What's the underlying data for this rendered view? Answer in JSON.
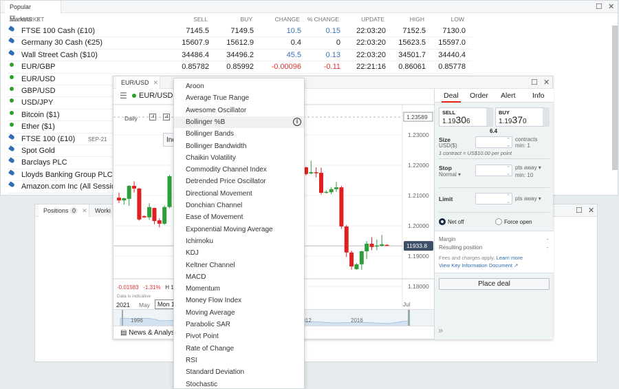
{
  "markets_panel": {
    "tab": "Popular Markets",
    "columns": [
      "MARKET",
      "SELL",
      "BUY",
      "CHANGE",
      "% CHANGE",
      "UPDATE",
      "HIGH",
      "LOW"
    ],
    "rows": [
      {
        "icon": "tag-icon",
        "name": "FTSE 100 Cash (£10)",
        "sell": "7145.5",
        "buy": "7149.5",
        "change": "10.5",
        "pct": "0.15",
        "update": "22:03:20",
        "high": "7152.5",
        "low": "7130.0",
        "dir": "up"
      },
      {
        "icon": "tag-icon",
        "name": "Germany 30 Cash (€25)",
        "sell": "15607.9",
        "buy": "15612.9",
        "change": "0.4",
        "pct": "0",
        "update": "22:03:20",
        "high": "15623.5",
        "low": "15597.0",
        "dir": "flat"
      },
      {
        "icon": "tag-icon",
        "name": "Wall Street Cash ($10)",
        "sell": "34486.4",
        "buy": "34496.2",
        "change": "45.5",
        "pct": "0.13",
        "update": "22:03:20",
        "high": "34501.7",
        "low": "34440.4",
        "dir": "up"
      },
      {
        "icon": "dot-icon",
        "name": "EUR/GBP",
        "sell": "0.85782",
        "buy": "0.85992",
        "change": "-0.00096",
        "pct": "-0.11",
        "update": "22:21:16",
        "high": "0.86061",
        "low": "0.85778",
        "dir": "down"
      },
      {
        "icon": "dot-icon",
        "name": "EUR/USD"
      },
      {
        "icon": "dot-icon",
        "name": "GBP/USD"
      },
      {
        "icon": "dot-icon",
        "name": "USD/JPY"
      },
      {
        "icon": "dot-icon",
        "name": "Bitcoin ($1)"
      },
      {
        "icon": "dot-icon",
        "name": "Ether ($1)"
      },
      {
        "icon": "tag-icon",
        "name": "FTSE 100 (£10)",
        "expiry": "SEP-21"
      },
      {
        "icon": "tag-icon",
        "name": "Spot Gold"
      },
      {
        "icon": "tag-icon",
        "name": "Barclays PLC"
      },
      {
        "icon": "tag-icon",
        "name": "Lloyds Banking Group PLC"
      },
      {
        "icon": "tag-icon",
        "name": "Amazon.com Inc (All Sessions)"
      }
    ]
  },
  "positions_panel": {
    "tab": "Positions",
    "count": "0",
    "tab2": "Worki"
  },
  "chart_window": {
    "tab": "EUR/USD",
    "market": "EUR/USD",
    "interval": "Daily",
    "indicators_btn": "Ind",
    "change": "-0.01583",
    "change_pct": "-1.31%",
    "high_prefix": "H 1.",
    "indicative": "Data is indicative",
    "x_labels": [
      "2021",
      "May",
      "Mon 10",
      "Jul"
    ],
    "nav_labels": [
      "1996",
      "2012",
      "2016"
    ],
    "news": "News & Analysis",
    "current_price": "11933.8",
    "marker_price": "1.23589",
    "y_ticks": [
      "1.23000",
      "1.22000",
      "1.21000",
      "1.20000",
      "1.19000",
      "1.18000"
    ],
    "colors": {
      "up": "#2f9e3a",
      "down": "#e02020"
    }
  },
  "chart_data": {
    "type": "candlestick",
    "y_ticks": [
      1.23,
      1.22,
      1.21,
      1.2,
      1.19,
      1.18
    ],
    "ylim": [
      1.1767,
      1.2405
    ],
    "candles": [
      [
        1.2093,
        1.211,
        1.2075,
        1.2084
      ],
      [
        1.2084,
        1.2093,
        1.207,
        1.2091
      ],
      [
        1.2089,
        1.2134,
        1.2066,
        1.2132
      ],
      [
        1.2132,
        1.2147,
        1.211,
        1.2123
      ],
      [
        1.2123,
        1.2125,
        1.2017,
        1.2021
      ],
      [
        1.2032,
        1.2034,
        1.2026,
        1.2028
      ],
      [
        1.2028,
        1.2075,
        1.202,
        1.2062
      ],
      [
        1.2059,
        1.206,
        1.2005,
        1.2016
      ],
      [
        1.2018,
        1.2025,
        1.1995,
        1.2007
      ],
      [
        1.2007,
        1.2067,
        1.2003,
        1.2062
      ],
      [
        1.2062,
        1.2168,
        1.2058,
        1.2164
      ],
      null,
      null,
      null,
      null,
      null,
      null,
      null,
      null,
      null,
      null,
      null,
      null,
      null,
      null,
      null,
      null,
      null,
      null,
      null,
      null,
      null,
      null,
      null,
      null,
      null,
      null,
      [
        1.2193,
        1.2195,
        1.2166,
        1.2171
      ],
      [
        1.2173,
        1.2215,
        1.217,
        1.2177
      ],
      [
        1.2177,
        1.2193,
        1.216,
        1.2174
      ],
      [
        1.2175,
        1.2192,
        1.2103,
        1.2109
      ],
      [
        1.211,
        1.2117,
        1.2107,
        1.2112
      ],
      [
        1.2111,
        1.2128,
        1.2104,
        1.2121
      ],
      [
        1.2121,
        1.2145,
        1.2112,
        1.2127
      ],
      [
        1.2127,
        1.2132,
        1.199,
        1.1998
      ],
      [
        1.1998,
        1.2003,
        1.1897,
        1.1912
      ],
      [
        1.1912,
        1.1918,
        1.1855,
        1.1866
      ],
      [
        1.1857,
        1.1877,
        1.1855,
        1.1873
      ],
      [
        1.1873,
        1.1918,
        1.1855,
        1.1916
      ],
      [
        1.1916,
        1.195,
        1.189,
        1.1941
      ],
      [
        1.1941,
        1.1962,
        1.192,
        1.193
      ],
      [
        1.1933,
        1.1955,
        1.192,
        1.1935
      ],
      [
        1.1934,
        1.197,
        1.1932,
        1.1939
      ],
      [
        1.1937,
        1.1939,
        1.1934,
        1.1935
      ]
    ]
  },
  "indicator_menu": {
    "items": [
      "Aroon",
      "Average True Range",
      "Awesome Oscillator",
      "Bollinger %B",
      "Bollinger Bands",
      "Bollinger Bandwidth",
      "Chaikin Volatility",
      "Commodity Channel Index",
      "Detrended Price Oscillator",
      "Directional Movement",
      "Donchian Channel",
      "Ease of Movement",
      "Exponential Moving Average",
      "Ichimoku",
      "KDJ",
      "Keltner Channel",
      "MACD",
      "Momentum",
      "Money Flow Index",
      "Moving Average",
      "Parabolic SAR",
      "Pivot Point",
      "Rate of Change",
      "RSI",
      "Standard Deviation",
      "Stochastic"
    ],
    "highlighted": "Bollinger %B"
  },
  "deal_ticket": {
    "tabs": [
      "Deal",
      "Order",
      "Alert",
      "Info"
    ],
    "active_tab": "Deal",
    "sell": {
      "label": "SELL",
      "prefix": "1.19",
      "big": "30",
      "suffix": "6"
    },
    "buy": {
      "label": "BUY",
      "prefix": "1.19",
      "big": "37",
      "suffix": "0"
    },
    "spread": "6.4",
    "size_label": "Size",
    "size_currency": "USD($)",
    "size_unit": "contracts",
    "size_min": "min: 1",
    "contract_note": "1 contract = US$10.00 per point",
    "stop_label": "Stop",
    "stop_type": "Normal ▾",
    "stop_unit": "pts away ▾",
    "stop_min": "min: 10",
    "limit_label": "Limit",
    "limit_unit": "pts away ▾",
    "net_off": "Net off",
    "force_open": "Force open",
    "selected_mode": "Net off",
    "margin_label": "Margin",
    "margin_value": "-",
    "resulting_label": "Resulting position",
    "resulting_value": "-",
    "fees": "Fees and charges apply.",
    "learn_more": "Learn more",
    "kid": "View Key Information Document",
    "place_deal": "Place deal",
    "accent": "#e02020"
  }
}
